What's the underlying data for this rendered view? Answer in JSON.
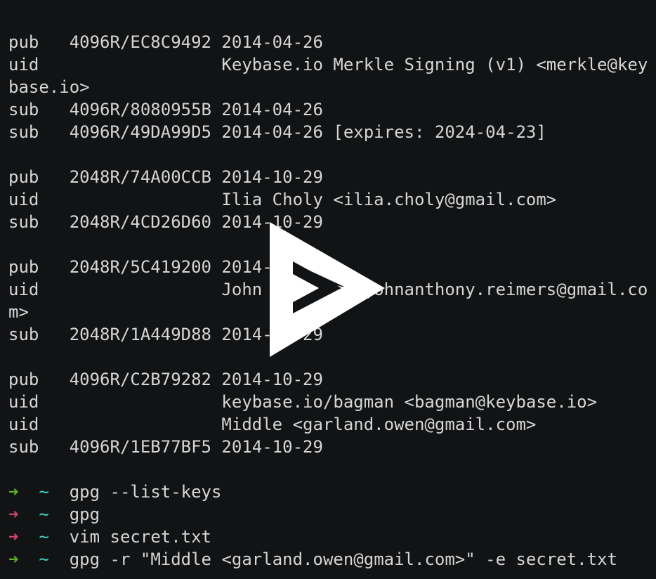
{
  "terminal": {
    "keys": [
      [
        {
          "type": "pub",
          "key": "4096R/EC8C9492",
          "date": "2014-04-26",
          "extra": ""
        },
        {
          "type": "uid",
          "text": "Keybase.io Merkle Signing (v1) <merkle@key",
          "continuation": "base.io>"
        },
        {
          "type": "sub",
          "key": "4096R/8080955B",
          "date": "2014-04-26",
          "extra": ""
        },
        {
          "type": "sub",
          "key": "4096R/49DA99D5",
          "date": "2014-04-26",
          "extra": "[expires: 2024-04-23]"
        }
      ],
      [
        {
          "type": "pub",
          "key": "2048R/74A00CCB",
          "date": "2014-10-29",
          "extra": ""
        },
        {
          "type": "uid",
          "text": "Ilia Choly <ilia.choly@gmail.com>"
        },
        {
          "type": "sub",
          "key": "2048R/4CD26D60",
          "date": "2014-10-29",
          "extra": ""
        }
      ],
      [
        {
          "type": "pub",
          "key": "2048R/5C419200",
          "date": "2014-10-29",
          "extra": ""
        },
        {
          "type": "uid",
          "text": "John Reimers <johnanthony.reimers@gmail.co",
          "continuation": "m>"
        },
        {
          "type": "sub",
          "key": "2048R/1A449D88",
          "date": "2014-10-29",
          "extra": ""
        }
      ],
      [
        {
          "type": "pub",
          "key": "4096R/C2B79282",
          "date": "2014-10-29",
          "extra": ""
        },
        {
          "type": "uid",
          "text": "keybase.io/bagman <bagman@keybase.io>"
        },
        {
          "type": "uid",
          "text": "Middle <garland.owen@gmail.com>"
        },
        {
          "type": "sub",
          "key": "4096R/1EB77BF5",
          "date": "2014-10-29",
          "extra": ""
        }
      ]
    ],
    "prompts": [
      {
        "status": "ok",
        "arrow": "➜",
        "dir": "~",
        "command": "gpg --list-keys"
      },
      {
        "status": "err",
        "arrow": "➜",
        "dir": "~",
        "command": "gpg"
      },
      {
        "status": "err",
        "arrow": "➜",
        "dir": "~",
        "command": "vim secret.txt"
      },
      {
        "status": "ok",
        "arrow": "➜",
        "dir": "~",
        "command": "gpg -r \"Middle <garland.owen@gmail.com>\" -e secret.txt"
      }
    ]
  },
  "overlay": {
    "icon": "asciinema-play-icon",
    "color": "#ffffff"
  },
  "colors": {
    "background": "#121314",
    "text": "#d6d6d6",
    "arrow_ok": "#5fb02a",
    "arrow_err": "#d2456a",
    "tilde": "#3fd4c0"
  }
}
